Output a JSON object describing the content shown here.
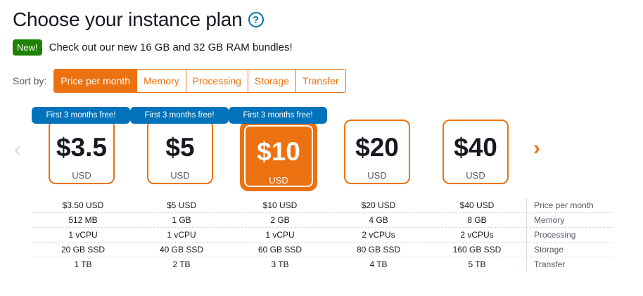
{
  "page": {
    "title": "Choose your instance plan",
    "help_icon": "?",
    "new_badge": "New!",
    "new_text": "Check out our new 16 GB and 32 GB RAM bundles!"
  },
  "sort": {
    "label": "Sort by:",
    "options": [
      "Price per month",
      "Memory",
      "Processing",
      "Storage",
      "Transfer"
    ],
    "active": "Price per month"
  },
  "navigation": {
    "prev_icon": "chevron-left-icon",
    "next_icon": "chevron-right-icon"
  },
  "plans": [
    {
      "badge": "First 3 months free!",
      "price": "$3.5",
      "currency": "USD",
      "selected": false
    },
    {
      "badge": "First 3 months free!",
      "price": "$5",
      "currency": "USD",
      "selected": false
    },
    {
      "badge": "First 3 months free!",
      "price": "$10",
      "currency": "USD",
      "selected": true
    },
    {
      "badge": "",
      "price": "$20",
      "currency": "USD",
      "selected": false
    },
    {
      "badge": "",
      "price": "$40",
      "currency": "USD",
      "selected": false
    }
  ],
  "specs": [
    {
      "label": "Price per month",
      "values": [
        "$3.50 USD",
        "$5 USD",
        "$10 USD",
        "$20 USD",
        "$40 USD"
      ]
    },
    {
      "label": "Memory",
      "values": [
        "512 MB",
        "1 GB",
        "2 GB",
        "4 GB",
        "8 GB"
      ]
    },
    {
      "label": "Processing",
      "values": [
        "1 vCPU",
        "1 vCPU",
        "1 vCPU",
        "2 vCPUs",
        "2 vCPUs"
      ]
    },
    {
      "label": "Storage",
      "values": [
        "20 GB SSD",
        "40 GB SSD",
        "60 GB SSD",
        "80 GB SSD",
        "160 GB SSD"
      ]
    },
    {
      "label": "Transfer",
      "values": [
        "1 TB",
        "2 TB",
        "3 TB",
        "4 TB",
        "5 TB"
      ]
    }
  ],
  "colors": {
    "accent": "#ec7211",
    "badge_blue": "#0073bb",
    "new_green": "#1d8102"
  }
}
